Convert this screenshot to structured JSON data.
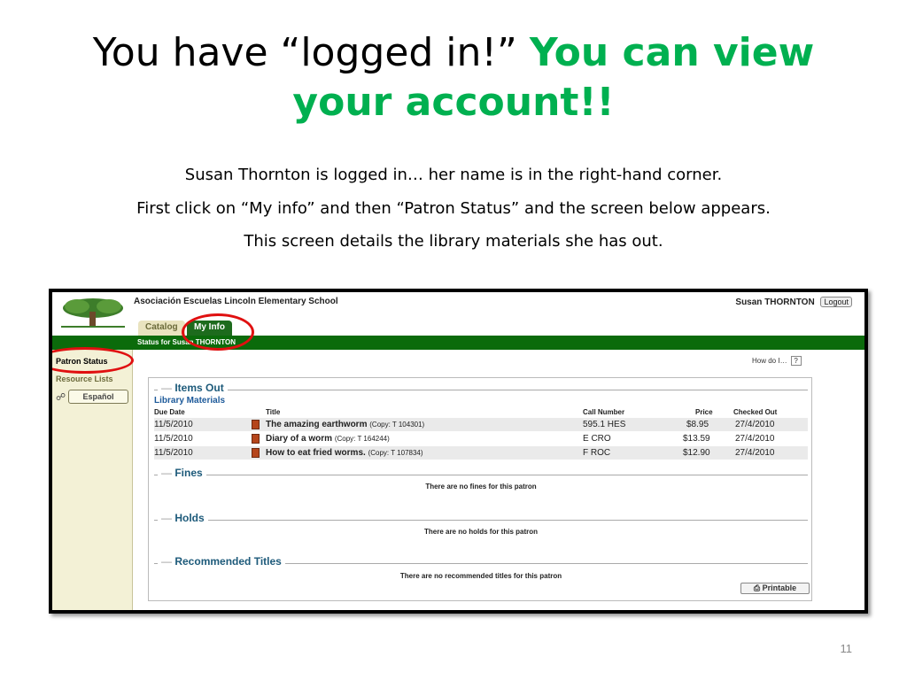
{
  "slide": {
    "title_black": "You have “logged in!”",
    "title_green_1": "You can view",
    "title_green_2": "your account!!",
    "desc_1": "Susan Thornton is logged in… her name is in the right-hand corner.",
    "desc_2": "First click on “My info” and then “Patron Status” and the screen below appears.",
    "desc_3": "This screen details the library materials she has out.",
    "page_number": "11"
  },
  "app": {
    "school_name": "Asociación Escuelas Lincoln Elementary School",
    "user_name": "Susan THORNTON",
    "logout_label": "Logout",
    "tabs": {
      "catalog": "Catalog",
      "my_info": "My Info"
    },
    "status_for": "Status for Susan THORNTON",
    "sidebar": {
      "patron_status": "Patron Status",
      "resource_lists": "Resource Lists",
      "espanol": "Español"
    },
    "how_do_i": "How do I…",
    "help_mark": "?",
    "items_out": {
      "heading": "Items Out",
      "subheading": "Library Materials",
      "columns": {
        "due": "Due Date",
        "title": "Title",
        "call": "Call Number",
        "price": "Price",
        "checked": "Checked Out"
      },
      "rows": [
        {
          "due": "11/5/2010",
          "title": "The amazing earthworm",
          "copy": "(Copy: T 104301)",
          "call": "595.1 HES",
          "price": "$8.95",
          "checked": "27/4/2010"
        },
        {
          "due": "11/5/2010",
          "title": "Diary of a worm",
          "copy": "(Copy: T 164244)",
          "call": "E CRO",
          "price": "$13.59",
          "checked": "27/4/2010"
        },
        {
          "due": "11/5/2010",
          "title": "How to eat fried worms.",
          "copy": "(Copy: T 107834)",
          "call": "F ROC",
          "price": "$12.90",
          "checked": "27/4/2010"
        }
      ]
    },
    "fines": {
      "heading": "Fines",
      "empty": "There are no fines for this patron"
    },
    "holds": {
      "heading": "Holds",
      "empty": "There are no holds for this patron"
    },
    "recommended": {
      "heading": "Recommended Titles",
      "empty": "There are no recommended titles for this patron"
    },
    "printable_label": "Printable"
  },
  "colors": {
    "title_green": "#00b050",
    "nav_green": "#0b6b0b",
    "highlight_ring": "#e01010",
    "heading_blue": "#1d5a7a"
  }
}
